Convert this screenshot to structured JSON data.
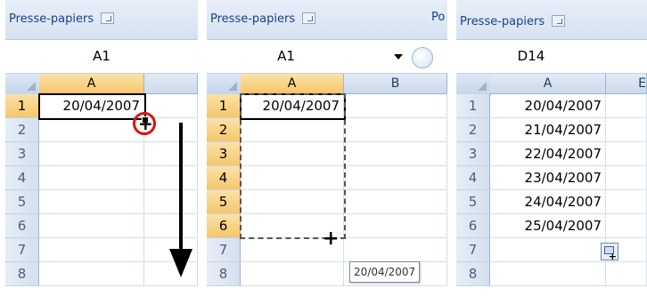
{
  "ribbon": {
    "group_label": "Presse-papiers",
    "tail_label": "Po"
  },
  "panel1": {
    "name_box": "A1",
    "columns": [
      "A"
    ],
    "rows": [
      "1",
      "2",
      "3",
      "4",
      "5",
      "6",
      "7",
      "8"
    ],
    "cells": [
      "20/04/2007",
      "",
      "",
      "",
      "",
      "",
      "",
      ""
    ]
  },
  "panel2": {
    "name_box": "A1",
    "columns": [
      "A",
      "B"
    ],
    "rows": [
      "1",
      "2",
      "3",
      "4",
      "5",
      "6",
      "7",
      "8"
    ],
    "cells": [
      "20/04/2007",
      "",
      "",
      "",
      "",
      "",
      "",
      ""
    ],
    "tooltip": "20/04/2007"
  },
  "panel3": {
    "name_box": "D14",
    "columns": [
      "A",
      "E"
    ],
    "rows": [
      "1",
      "2",
      "3",
      "4",
      "5",
      "6",
      "7",
      "8"
    ],
    "cells": [
      "20/04/2007",
      "21/04/2007",
      "22/04/2007",
      "23/04/2007",
      "24/04/2007",
      "25/04/2007",
      "",
      ""
    ]
  },
  "icons": {
    "fill_cursor": "plus-crosshair-icon",
    "arrow": "down-arrow-icon",
    "autofill_options": "autofill-options-icon"
  },
  "colors": {
    "selected_header": "#f6c66b",
    "highlight_circle": "#e01010",
    "ribbon_text": "#15428b"
  }
}
